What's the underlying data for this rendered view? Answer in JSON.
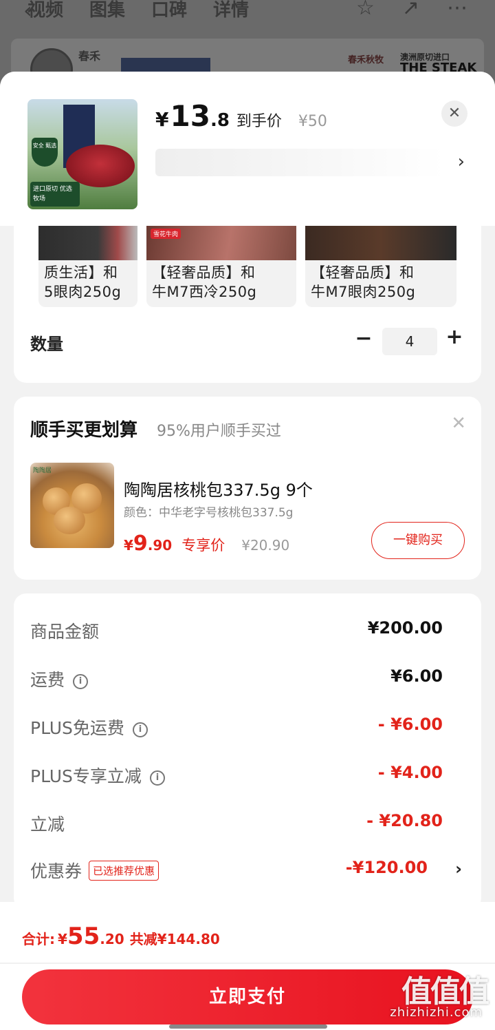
{
  "background": {
    "tabs": [
      "视频",
      "图集",
      "口碑",
      "详情"
    ],
    "brand_left": "春禾",
    "brand_right_1": "春禾秋牧",
    "brand_right_2": "澳洲原切进口",
    "brand_right_3": "THE STEAK"
  },
  "product": {
    "image_label": "进口原切 优选牧场",
    "image_shield": "安全 甄选",
    "price_currency": "¥",
    "price_int": "13",
    "price_dec": ".8",
    "price_label": "到手价",
    "original_price": "¥50"
  },
  "options": [
    {
      "text": "质生活】和\n5眼肉250g"
    },
    {
      "text": "【轻奢品质】和\n牛M7西冷250g",
      "badge": "雪花牛肉"
    },
    {
      "text": "【轻奢品质】和\n牛M7眼肉250g"
    }
  ],
  "quantity": {
    "label": "数量",
    "value": "4",
    "minus": "−",
    "plus": "+"
  },
  "addon": {
    "title": "顺手买更划算",
    "subtitle": "95%用户顺手买过",
    "item_name": "陶陶居核桃包337.5g 9个",
    "item_spec": "颜色：中华老字号核桃包337.5g",
    "price_currency": "¥",
    "price_int": "9",
    "price_dec": ".90",
    "price_label": "专享价",
    "original_price": "¥20.90",
    "buy_label": "一键购买",
    "image_label": "陶陶居"
  },
  "summary": {
    "rows": [
      {
        "label": "商品金额",
        "value": "¥200.00"
      },
      {
        "label": "运费",
        "value": "¥6.00"
      },
      {
        "label": "PLUS免运费",
        "value": "- ¥6.00"
      },
      {
        "label": "PLUS专享立减",
        "value": "- ¥4.00"
      },
      {
        "label": "立减",
        "value": "- ¥20.80"
      },
      {
        "label": "优惠券",
        "value": "-¥120.00",
        "tag": "已选推荐优惠"
      }
    ]
  },
  "footer": {
    "total_label": "合计:",
    "total_currency": "¥",
    "total_int": "55",
    "total_dec": ".20",
    "savings": "共减¥144.80",
    "pay_label": "立即支付"
  },
  "watermark": {
    "text": "值值值",
    "sub": "zhizhizhi.com"
  },
  "colors": {
    "accent": "#e2231a",
    "sheet_bg": "#f2f2f2"
  }
}
